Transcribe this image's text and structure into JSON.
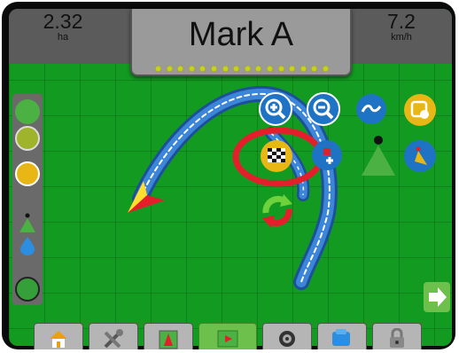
{
  "screen": {
    "title": "Mark A",
    "area": {
      "value": "2.32",
      "unit": "ha"
    },
    "speed": {
      "value": "7.2",
      "unit": "km/h"
    },
    "progress_dots": 16
  },
  "colors": {
    "field": "#139b21",
    "path": "#2b6fc1",
    "highlight_ring": "#e41e2b",
    "panel": "#5b5b5b",
    "accent_green": "#6dc04c",
    "accent_yellow": "#e8b716"
  },
  "map_tools": [
    {
      "name": "zoom-in",
      "icon": "zoom-in-icon"
    },
    {
      "name": "zoom-out",
      "icon": "zoom-out-icon"
    },
    {
      "name": "path-view",
      "icon": "path-icon"
    },
    {
      "name": "boundary",
      "icon": "boundary-icon"
    },
    {
      "name": "mark-a",
      "icon": "checkered-flag-icon"
    },
    {
      "name": "add-marker",
      "icon": "add-marker-icon"
    },
    {
      "name": "vehicle-view",
      "icon": "vehicle-view-icon"
    },
    {
      "name": "angle-view",
      "icon": "angle-view-icon"
    },
    {
      "name": "reset",
      "icon": "refresh-icon"
    }
  ],
  "bottom_tabs": [
    {
      "name": "home",
      "icon": "home-icon"
    },
    {
      "name": "tools",
      "icon": "tools-icon"
    },
    {
      "name": "field-map",
      "icon": "field-icon"
    },
    {
      "name": "guidance",
      "icon": "guidance-icon",
      "active": true
    },
    {
      "name": "camera",
      "icon": "camera-icon"
    },
    {
      "name": "data",
      "icon": "data-icon"
    },
    {
      "name": "lock",
      "icon": "lock-icon"
    }
  ]
}
